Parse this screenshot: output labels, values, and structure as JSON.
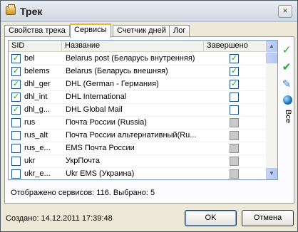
{
  "window": {
    "title": "Трек",
    "close_glyph": "×"
  },
  "tabs": [
    {
      "label": "Свойства трека"
    },
    {
      "label": "Сервисы"
    },
    {
      "label": "Счетчик дней"
    },
    {
      "label": "Лог"
    }
  ],
  "table": {
    "columns": {
      "sid": "SID",
      "name": "Название",
      "done": "Завершено"
    },
    "rows": [
      {
        "checked": true,
        "sid": "bel",
        "name": "Belarus post (Беларусь внутренняя)",
        "done": "checked"
      },
      {
        "checked": true,
        "sid": "belems",
        "name": "Belarus  (Беларусь внешняя)",
        "done": "checked"
      },
      {
        "checked": true,
        "sid": "dhl_ger",
        "name": "DHL (German - Германия)",
        "done": "checked"
      },
      {
        "checked": true,
        "sid": "dhl_int",
        "name": "DHL International",
        "done": "empty"
      },
      {
        "checked": true,
        "sid": "dhl_g...",
        "name": "DHL Global Mail",
        "done": "empty"
      },
      {
        "checked": false,
        "sid": "rus",
        "name": "Почта России (Russia)",
        "done": "gray"
      },
      {
        "checked": false,
        "sid": "rus_alt",
        "name": "Почта России альтернативный(Ru...",
        "done": "gray"
      },
      {
        "checked": false,
        "sid": "rus_e...",
        "name": "EMS Почта России",
        "done": "gray"
      },
      {
        "checked": false,
        "sid": "ukr",
        "name": "УкрПочта",
        "done": "gray"
      },
      {
        "checked": false,
        "sid": "ukr_e...",
        "name": "Ukr EMS (Украина)",
        "done": "gray"
      }
    ]
  },
  "side_tools": {
    "icons": [
      "check-icon",
      "check-all-icon",
      "uncheck-icon",
      "globe-icon"
    ],
    "all_label": "Все"
  },
  "status": "Отображено сервисов: 116. Выбрано: 5",
  "footer": {
    "created": "Создано: 14.12.2011 17:39:48",
    "ok_label": "OK",
    "cancel_label": "Отмена"
  },
  "colors": {
    "check_green": "#21a121",
    "tab_accent": "#f1b33b"
  }
}
